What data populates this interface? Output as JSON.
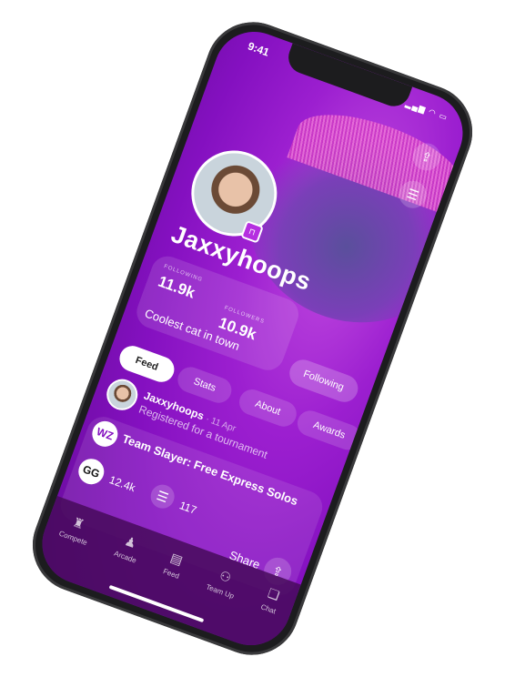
{
  "status": {
    "time": "9:41",
    "icons": "▂▄▆ ◠ ▭"
  },
  "profile": {
    "username": "Jaxxyhoops",
    "following_label": "FOLLOWING",
    "following_count": "11.9k",
    "followers_label": "FOLLOWERS",
    "followers_count": "10.9k",
    "bio": "Coolest cat in town",
    "follow_button": "Following"
  },
  "tabs": [
    "Feed",
    "Stats",
    "About",
    "Awards"
  ],
  "feed_item": {
    "user": "Jaxxyhoops",
    "date": "· 11 Apr",
    "activity": "Registered for a tournament"
  },
  "post": {
    "logo": "WZ",
    "title": "Team Slayer: Free Express Solos",
    "org_logo": "GG",
    "views": "12.4k",
    "comments": "117",
    "share_label": "Share"
  },
  "nav": [
    {
      "label": "Compete",
      "icon": "trophy-icon"
    },
    {
      "label": "Arcade",
      "icon": "arcade-icon"
    },
    {
      "label": "Feed",
      "icon": "feed-icon"
    },
    {
      "label": "Team Up",
      "icon": "team-icon"
    },
    {
      "label": "Chat",
      "icon": "chat-icon"
    }
  ],
  "colors": {
    "accent": "#8410c0",
    "tab_active": "#ffffff"
  }
}
